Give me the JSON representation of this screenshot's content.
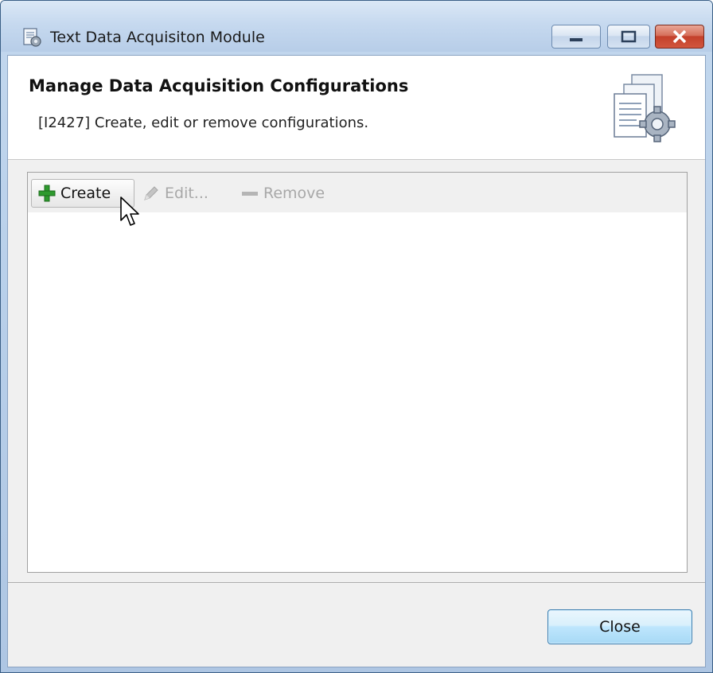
{
  "window": {
    "title": "Text Data Acquisiton Module",
    "controls": {
      "minimize": "minimize-icon",
      "maximize": "maximize-icon",
      "close": "close-icon"
    }
  },
  "banner": {
    "title": "Manage Data Acquisition Configurations",
    "description": "[I2427] Create, edit or remove configurations.",
    "icon": "documents-gear-icon"
  },
  "toolbar": {
    "create_label": "Create",
    "edit_label": "Edit...",
    "remove_label": "Remove"
  },
  "configurations": [],
  "footer": {
    "close_label": "Close"
  },
  "colors": {
    "create_icon": "#2e9a2e",
    "disabled_text": "#a8a8a8",
    "close_button_border": "#3c7fb1"
  }
}
